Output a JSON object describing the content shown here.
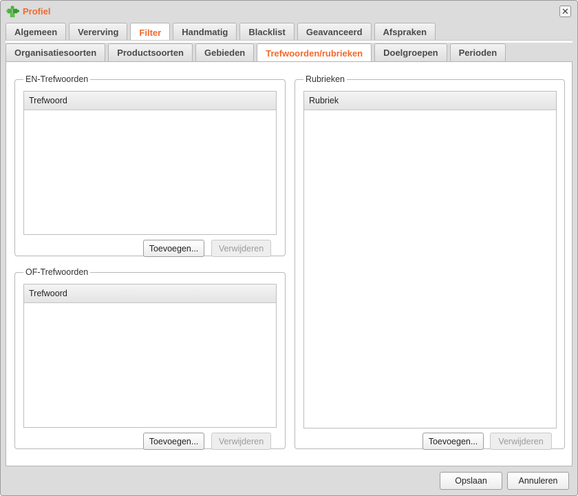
{
  "window": {
    "title": "Profiel"
  },
  "icons": {
    "app": "puzzle-icon",
    "close": "close-icon"
  },
  "colors": {
    "accent": "#f26a2b"
  },
  "tabs_primary": [
    {
      "label": "Algemeen",
      "active": false
    },
    {
      "label": "Vererving",
      "active": false
    },
    {
      "label": "Filter",
      "active": true
    },
    {
      "label": "Handmatig",
      "active": false
    },
    {
      "label": "Blacklist",
      "active": false
    },
    {
      "label": "Geavanceerd",
      "active": false
    },
    {
      "label": "Afspraken",
      "active": false
    }
  ],
  "tabs_secondary": [
    {
      "label": "Organisatiesoorten",
      "active": false
    },
    {
      "label": "Productsoorten",
      "active": false
    },
    {
      "label": "Gebieden",
      "active": false
    },
    {
      "label": "Trefwoorden/rubrieken",
      "active": true
    },
    {
      "label": "Doelgroepen",
      "active": false
    },
    {
      "label": "Perioden",
      "active": false
    }
  ],
  "en_group": {
    "legend": "EN-Trefwoorden",
    "column": "Trefwoord",
    "add": "Toevoegen...",
    "remove": "Verwijderen"
  },
  "of_group": {
    "legend": "OF-Trefwoorden",
    "column": "Trefwoord",
    "add": "Toevoegen...",
    "remove": "Verwijderen"
  },
  "rubrieken_group": {
    "legend": "Rubrieken",
    "column": "Rubriek",
    "add": "Toevoegen...",
    "remove": "Verwijderen"
  },
  "footer": {
    "save": "Opslaan",
    "cancel": "Annuleren"
  }
}
